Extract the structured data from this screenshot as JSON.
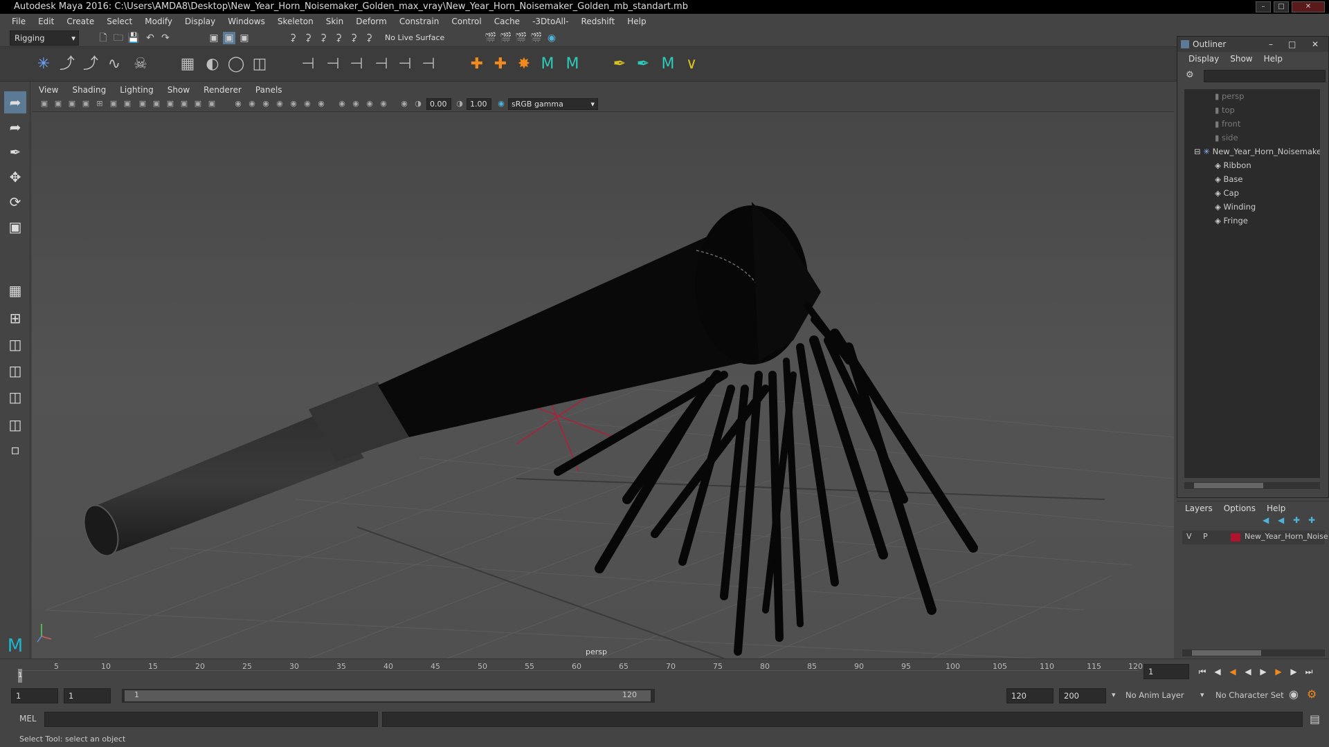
{
  "window": {
    "title": "Autodesk Maya 2016: C:\\Users\\AMDA8\\Desktop\\New_Year_Horn_Noisemaker_Golden_max_vray\\New_Year_Horn_Noisemaker_Golden_mb_standart.mb"
  },
  "menu_bar": {
    "items": [
      "File",
      "Edit",
      "Create",
      "Select",
      "Modify",
      "Display",
      "Windows",
      "Skeleton",
      "Skin",
      "Deform",
      "Constrain",
      "Control",
      "Cache",
      "-3DtoAll-",
      "Redshift",
      "Help"
    ]
  },
  "status_line": {
    "mode": "Rigging",
    "live_surface": "No Live Surface"
  },
  "viewport": {
    "menu": [
      "View",
      "Shading",
      "Lighting",
      "Show",
      "Renderer",
      "Panels"
    ],
    "exposure": "0.00",
    "gamma": "1.00",
    "color_space": "sRGB gamma",
    "camera_label": "persp"
  },
  "outliner": {
    "title": "Outliner",
    "menu": [
      "Display",
      "Show",
      "Help"
    ],
    "cameras": [
      "persp",
      "top",
      "front",
      "side"
    ],
    "root": "New_Year_Horn_Noisemaker",
    "children": [
      "Ribbon",
      "Base",
      "Cap",
      "Winding",
      "Fringe"
    ]
  },
  "layers": {
    "menu": [
      "Layers",
      "Options",
      "Help"
    ],
    "v_label": "V",
    "p_label": "P",
    "layer_name": "New_Year_Horn_Noise",
    "layer_color": "#b0142c"
  },
  "time_slider": {
    "ticks": [
      "5",
      "10",
      "15",
      "20",
      "25",
      "30",
      "35",
      "40",
      "45",
      "50",
      "55",
      "60",
      "65",
      "70",
      "75",
      "80",
      "85",
      "90",
      "95",
      "100",
      "105",
      "110",
      "115",
      "120"
    ],
    "current_frame_marker": "1",
    "current_frame": "1"
  },
  "range_slider": {
    "start": "1",
    "playback_start": "1",
    "range_start_label": "1",
    "range_end_label": "120",
    "playback_end": "120",
    "end": "200",
    "anim_layer": "No Anim Layer",
    "character_set": "No Character Set"
  },
  "command_line": {
    "label": "MEL"
  },
  "help_line": {
    "text": "Select Tool: select an object"
  }
}
